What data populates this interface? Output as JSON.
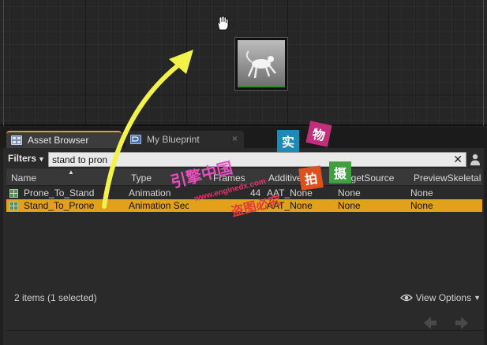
{
  "graph": {
    "node_thumbnail": "animation-preview-thumbnail"
  },
  "tabs": [
    {
      "label": "Asset Browser",
      "active": true,
      "icon": "asset-browser-icon"
    },
    {
      "label": "My Blueprint",
      "active": false,
      "icon": "blueprint-icon",
      "close": "×"
    }
  ],
  "filter": {
    "label": "Filters",
    "search_value": "stand to pron",
    "clear": "✕"
  },
  "columns": [
    "Name",
    "Type",
    "Frames",
    "Additive",
    "TargetSource",
    "PreviewSkeletal"
  ],
  "rows": [
    {
      "name": "Prone_To_Stand",
      "type": "Animation",
      "frames": "44",
      "additive": "AAT_None",
      "target": "None",
      "preview": "None",
      "selected": false
    },
    {
      "name": "Stand_To_Prone",
      "type": "Animation Sec",
      "frames": "",
      "additive": "AAT_None",
      "target": "None",
      "preview": "None",
      "selected": true
    }
  ],
  "status": "2 items (1 selected)",
  "view_options": "View Options",
  "nav": {
    "back": "back-arrow-icon",
    "forward": "forward-arrow-icon"
  },
  "colors": {
    "selection": "#e3a01a",
    "tab_accent": "#e0a21a",
    "annotation_arrow": "#f2f24a"
  },
  "watermark": {
    "line1": "引擎中国",
    "url": "www.enginedx.com",
    "line2": "盗图必究",
    "stamps": [
      "实",
      "物",
      "拍",
      "摄"
    ]
  }
}
